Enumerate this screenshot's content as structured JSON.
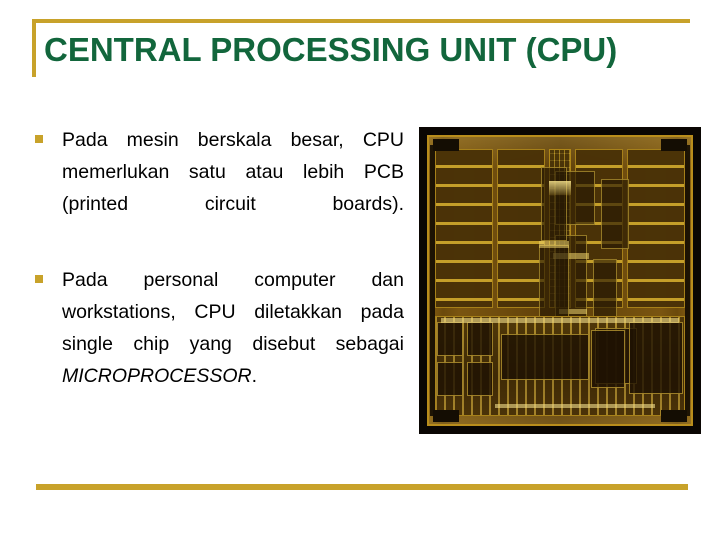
{
  "slide": {
    "title": "CENTRAL PROCESSING UNIT (CPU)",
    "bullets": [
      {
        "text_before_italic": "Pada mesin berskala besar, CPU memerlukan satu atau lebih PCB (printed circuit boards).",
        "italic": "",
        "text_after_italic": ""
      },
      {
        "text_before_italic": "Pada personal computer dan workstations, CPU diletakkan pada single chip yang disebut sebagai ",
        "italic": "MICROPROCESSOR",
        "text_after_italic": "."
      }
    ],
    "image": {
      "name": "cpu-die-photograph",
      "alt": "Photomicrograph of a microprocessor die in gold and amber tones"
    },
    "colors": {
      "title_green": "#12663C",
      "accent_gold": "#C8A22A",
      "body_black": "#000000",
      "background": "#FFFFFF"
    }
  }
}
